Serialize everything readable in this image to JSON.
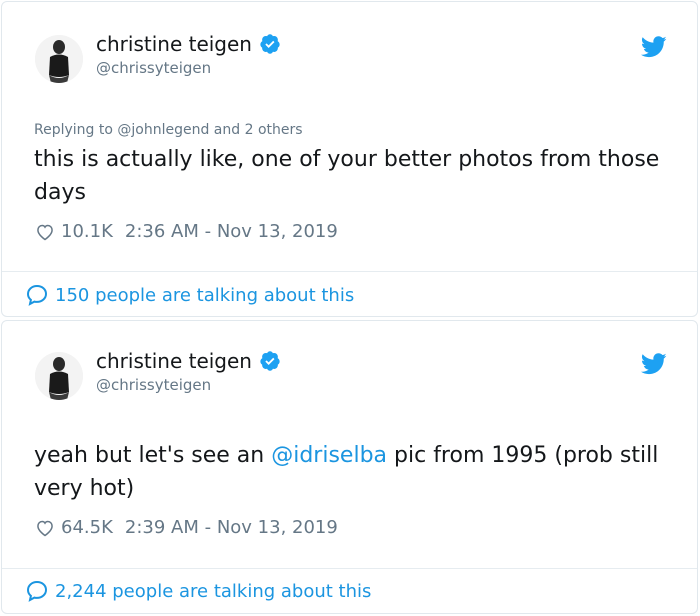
{
  "tweets": [
    {
      "author": {
        "name": "christine teigen",
        "handle": "@chrissyteigen",
        "verified": true
      },
      "reply": {
        "prefix": "Replying to ",
        "user": "@johnlegend",
        "suffix": " and 2 others"
      },
      "text": {
        "before": "this is actually like, one of your better photos from those days",
        "mention": "",
        "after": ""
      },
      "likes": "10.1K",
      "timestamp": "2:36 AM - Nov 13, 2019",
      "talking": "150 people are talking about this"
    },
    {
      "author": {
        "name": "christine teigen",
        "handle": "@chrissyteigen",
        "verified": true
      },
      "reply": null,
      "text": {
        "before": "yeah but let's see an ",
        "mention": "@idriselba",
        "after": " pic from 1995 (prob still very hot)"
      },
      "likes": "64.5K",
      "timestamp": "2:39 AM - Nov 13, 2019",
      "talking": "2,244 people are talking about this"
    }
  ],
  "icons": {
    "verified": "verified-badge-icon",
    "twitter": "twitter-bird-icon",
    "like": "heart-icon",
    "conversation": "speech-bubble-icon"
  },
  "colors": {
    "accent": "#1b95e0",
    "twitter_blue": "#1da1f2",
    "secondary_text": "#657786",
    "border": "#e1e8ed"
  }
}
